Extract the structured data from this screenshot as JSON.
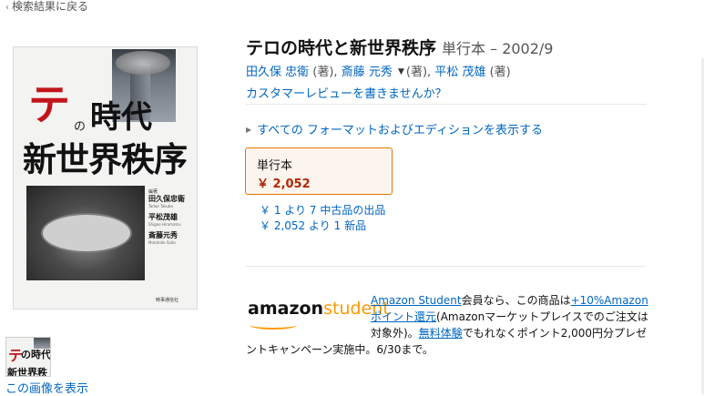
{
  "nav": {
    "back_label": "検索結果に戻る",
    "back_icon": "chevron-left-icon"
  },
  "cover": {
    "title_first_char": "テ",
    "title_no": "の",
    "title_jidai": "時代",
    "title_line2": "新世界秩序",
    "authors_label": "編著",
    "authors": [
      {
        "name": "田久保忠衛",
        "roman": "Tadae Takubo"
      },
      {
        "name": "平松茂雄",
        "roman": "Shigeo Hiramatsu"
      },
      {
        "name": "斎藤元秀",
        "roman": "Motohide Saito"
      }
    ],
    "publisher": "時事通信社"
  },
  "product": {
    "title": "テロの時代と新世界秩序",
    "subtitle": "単行本 – 2002/9",
    "authors_line": {
      "author1": "田久保 忠衛",
      "role1": "(著),",
      "author2": "斎藤 元秀",
      "role2": "(著),",
      "author3": "平松 茂雄",
      "role3": "(著)"
    },
    "review_link": "カスタマーレビューを書きませんか？",
    "formats_link": "すべての フォーマットおよびエディションを表示する",
    "format_swatch": {
      "format": "単行本",
      "price": "￥ 2,052"
    },
    "offers": [
      {
        "price": "￥ 1",
        "text": "より",
        "count": "7",
        "condition": "中古品の出品"
      },
      {
        "price": "￥ 2,052",
        "text": "より",
        "count": "1",
        "condition": "新品"
      }
    ]
  },
  "promo": {
    "logo_amazon": "amazon",
    "logo_student": "student",
    "line1_link": "Amazon Student",
    "line1_text": "会員なら、この商品は",
    "line1_link2": "+10%Amazon",
    "line2_link": "ポイント還元",
    "line2_text": "(Amazonマーケットプレイスでのご注文は",
    "line3_text1": "対象外)。",
    "line3_link": "無料体験",
    "line3_text2": "でもれなくポイント2,000円分プレゼ",
    "line4_text": "ントキャンペーン実施中。6/30まで。"
  },
  "thumbnail": {
    "t1": "テ",
    "t2": "の時代",
    "t3": "新世界秩",
    "view_image_link": "この画像を表示"
  },
  "colors": {
    "link": "#0066c0",
    "price": "#b12704",
    "swatch_border": "#e77600",
    "swatch_bg": "#fcf5ee",
    "student_orange": "#ff9900",
    "cover_red": "#c2151b"
  }
}
